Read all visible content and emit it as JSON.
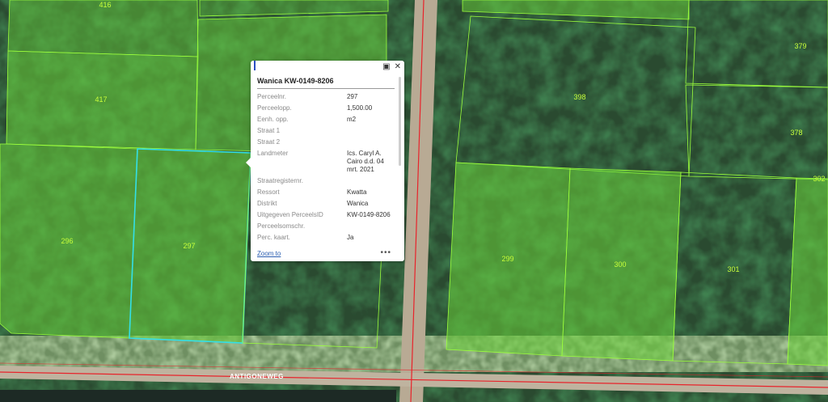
{
  "map": {
    "parcel_labels": [
      {
        "id": "416",
        "text": "416"
      },
      {
        "id": "417",
        "text": "417"
      },
      {
        "id": "296",
        "text": "296"
      },
      {
        "id": "297",
        "text": "297"
      },
      {
        "id": "398",
        "text": "398"
      },
      {
        "id": "379",
        "text": "379"
      },
      {
        "id": "378",
        "text": "378"
      },
      {
        "id": "302",
        "text": "302"
      },
      {
        "id": "299",
        "text": "299"
      },
      {
        "id": "300",
        "text": "300"
      },
      {
        "id": "301",
        "text": "301"
      }
    ],
    "road_label": "ANTIGONEWEG",
    "colors": {
      "parcel_fill": "#6bd33a",
      "parcel_outline": "#9cff3c",
      "selected_outline": "#33e0e8",
      "road_line": "#e8232b",
      "label": "#c8ff3a"
    }
  },
  "popup": {
    "title": "Wanica KW-0149-8206",
    "maximize_icon": "maximize-icon",
    "close_icon": "close-icon",
    "attributes": [
      {
        "key": "Perceelnr.",
        "value": "297"
      },
      {
        "key": "Perceelopp.",
        "value": "1,500.00"
      },
      {
        "key": "Eenh. opp.",
        "value": "m2"
      },
      {
        "key": "Straat 1",
        "value": ""
      },
      {
        "key": "Straat 2",
        "value": ""
      },
      {
        "key": "Landmeter",
        "value": "Ics. Caryl A. Cairo d.d. 04 mrt. 2021"
      },
      {
        "key": "Straatregisternr.",
        "value": ""
      },
      {
        "key": "Ressort",
        "value": "Kwatta"
      },
      {
        "key": "Distrikt",
        "value": "Wanica"
      },
      {
        "key": "Uitgegeven PerceelsID",
        "value": "KW-0149-8206"
      },
      {
        "key": "Perceelsomschr.",
        "value": ""
      },
      {
        "key": "Perc. kaart.",
        "value": "Ja"
      }
    ],
    "zoom_to": "Zoom to",
    "more_label": "•••"
  }
}
